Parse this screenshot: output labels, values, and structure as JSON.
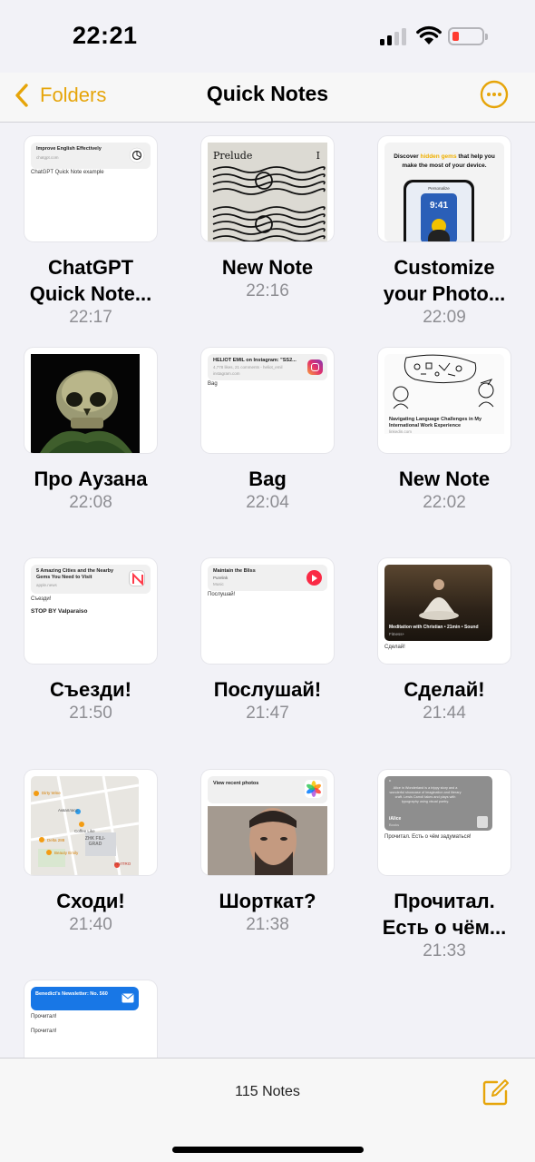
{
  "status_bar": {
    "time": "22:21"
  },
  "nav": {
    "back_label": "Folders",
    "title": "Quick Notes"
  },
  "colors": {
    "accent": "#e6a50a",
    "battery": "#ff3b30"
  },
  "notes": [
    {
      "title": "ChatGPT\nQuick Note...",
      "time": "22:17",
      "preview": {
        "card_title": "Improve English Effectively",
        "card_sub": "chatgpt.com",
        "body": "ChatGPT Quick Note example"
      }
    },
    {
      "title": "New Note",
      "time": "22:16",
      "preview": {
        "card_title": "Prelude",
        "card_sub": "I"
      }
    },
    {
      "title": "Customize\nyour Photo...",
      "time": "22:09",
      "preview": {
        "line1a": "Discover ",
        "line1b": "hidden gems",
        "line1c": " that help you",
        "line2": "make the most of your device.",
        "phone_time": "9:41",
        "phone_label": "Personalize"
      }
    },
    {
      "title": "Про Аузана",
      "time": "22:08",
      "preview": {}
    },
    {
      "title": "Bag",
      "time": "22:04",
      "preview": {
        "card_title": "HELIOT EMIL on Instagram: \"SS2...",
        "card_sub": "4,778 likes, 21 comments - heliot_emil",
        "card_sub2": "instagram.com",
        "body": "Bag"
      }
    },
    {
      "title": "New Note",
      "time": "22:02",
      "preview": {
        "card_title": "Navigating Language Challenges in My",
        "card_title2": "International Work Experience",
        "card_sub": "linkedin.com"
      }
    },
    {
      "title": "Съезди!",
      "time": "21:50",
      "preview": {
        "card_title": "5 Amazing Cities and the Nearby",
        "card_title2": "Gems You Need to Visit",
        "card_sub": "apple.news",
        "body": "Съезди!",
        "body2": "STOP BY Valparaiso"
      }
    },
    {
      "title": "Послушай!",
      "time": "21:47",
      "preview": {
        "card_title": "Maintain the Bliss",
        "card_sub": "Purelink",
        "card_sub2": "Music",
        "body": "Послушай!"
      }
    },
    {
      "title": "Сделай!",
      "time": "21:44",
      "preview": {
        "card_title": "Meditation with Christian • 21min • Sound",
        "card_sub": "Fitness+",
        "body": "Сделай!"
      }
    },
    {
      "title": "Сходи!",
      "time": "21:40",
      "preview": {
        "labels": [
          "Dirty Wine",
          "Аквапласс",
          "Coffee Like",
          "Delta 288",
          "ZHK FILI-GRAD",
          "Beauty Emily",
          "INVITRO"
        ]
      }
    },
    {
      "title": "Шорткат?",
      "time": "21:38",
      "preview": {
        "card_title": "View recent photos"
      }
    },
    {
      "title": "Прочитал.\nЕсть о чём...",
      "time": "21:33",
      "preview": {
        "quote": "Alice in Wonderland is a trippy story and a wonderful showcase of imagination and literary craft. Lewis Carroll takes and plays with typography using visual poetry.",
        "card_title": "iAlice",
        "card_sub": "Books",
        "body": "Прочитал. Есть о чём задуматься!"
      }
    },
    {
      "title": "",
      "time": "",
      "preview": {
        "card_title": "Benedict's Newsletter: No. 560",
        "body": "Прочитал!",
        "body2": "Прочитал!"
      }
    }
  ],
  "toolbar": {
    "count": "115 Notes"
  }
}
